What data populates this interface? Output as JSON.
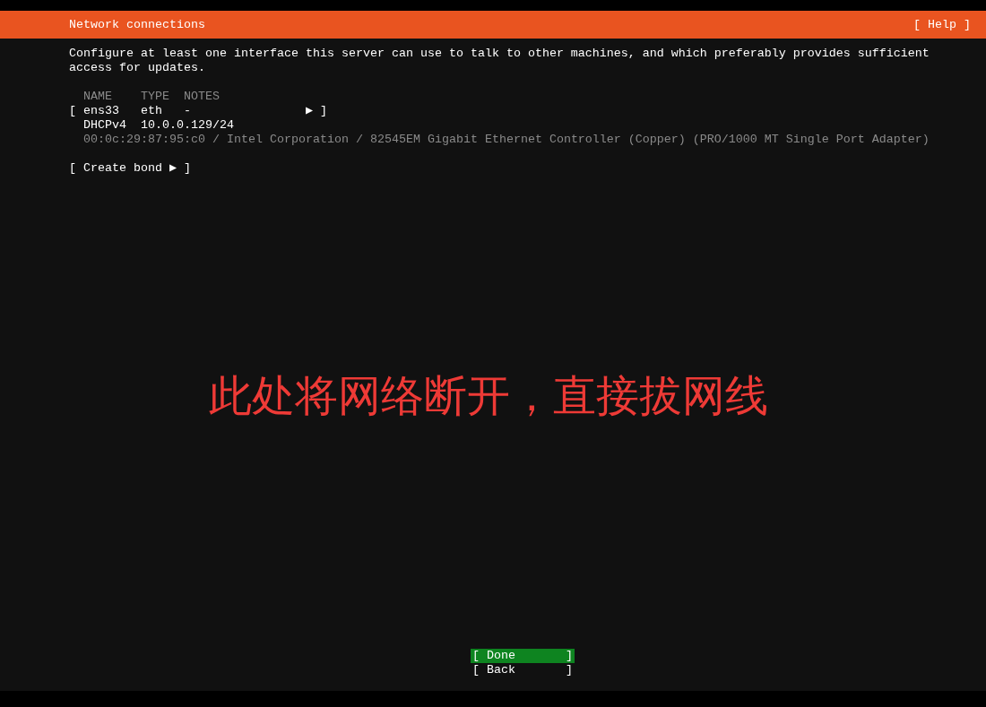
{
  "header": {
    "title": "Network connections",
    "help": "[ Help ]"
  },
  "description": "Configure at least one interface this server can use to talk to other machines, and which preferably provides sufficient access for updates.",
  "columns": [
    "NAME",
    "TYPE",
    "NOTES"
  ],
  "interfaces": [
    {
      "open": "[",
      "name": "ens33",
      "type": "eth",
      "notes": "-",
      "arrow": "▶",
      "close": "]",
      "address_method": "DHCPv4",
      "address": "10.0.0.129/24",
      "details": "00:0c:29:87:95:c0 / Intel Corporation / 82545EM Gigabit Ethernet Controller (Copper) (PRO/1000 MT Single Port Adapter)"
    }
  ],
  "create_bond": "[ Create bond ▶ ]",
  "annotation": "此处将网络断开，直接拔网线",
  "buttons": [
    {
      "label": "[ Done       ]",
      "selected": true
    },
    {
      "label": "[ Back       ]",
      "selected": false
    }
  ]
}
